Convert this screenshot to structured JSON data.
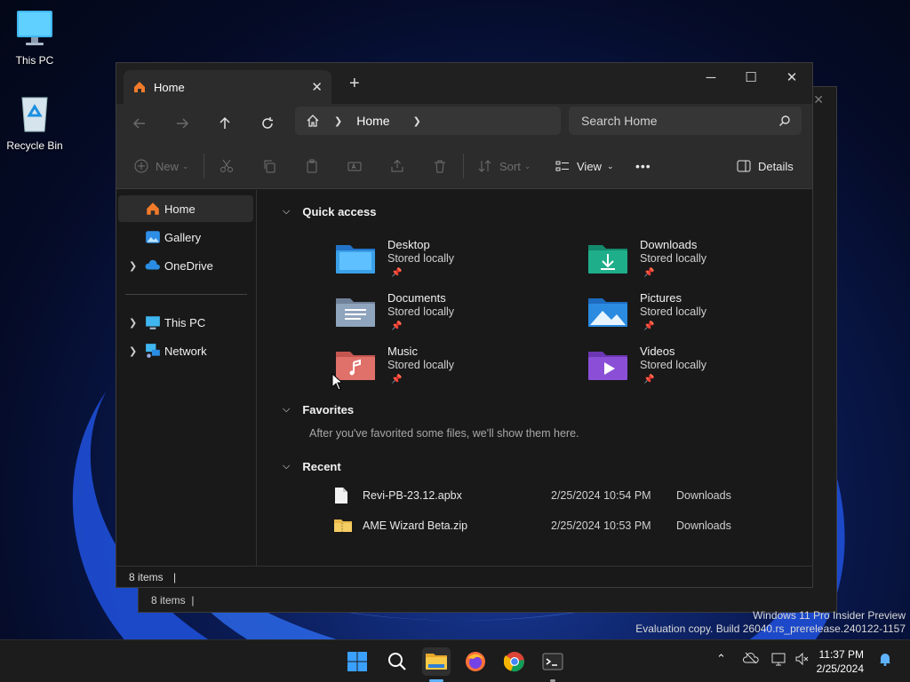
{
  "desktop": {
    "icons": [
      {
        "label": "This PC"
      },
      {
        "label": "Recycle Bin"
      }
    ],
    "watermark": {
      "line1": "Windows 11 Pro Insider Preview",
      "line2": "Evaluation copy. Build 26040.rs_prerelease.240122-1157"
    }
  },
  "background_window": {
    "status": "8 items"
  },
  "window": {
    "tab_title": "Home",
    "controls": {
      "minimize": "─",
      "maximize": "☐",
      "close": "✕"
    },
    "address": {
      "crumb": "Home"
    },
    "search": {
      "placeholder": "Search Home"
    },
    "toolbar": {
      "new": "New",
      "sort": "Sort",
      "view": "View",
      "more": "•••",
      "details": "Details"
    },
    "sidebar": {
      "items": [
        {
          "label": "Home"
        },
        {
          "label": "Gallery"
        },
        {
          "label": "OneDrive"
        },
        {
          "label": "This PC"
        },
        {
          "label": "Network"
        }
      ]
    },
    "sections": {
      "quick_access": "Quick access",
      "favorites": "Favorites",
      "favorites_empty": "After you've favorited some files, we'll show them here.",
      "recent": "Recent"
    },
    "quick_access": [
      {
        "name": "Desktop",
        "status": "Stored locally",
        "color": "#3aa0e8"
      },
      {
        "name": "Downloads",
        "status": "Stored locally",
        "color": "#1fae8a"
      },
      {
        "name": "Documents",
        "status": "Stored locally",
        "color": "#8fa4bd"
      },
      {
        "name": "Pictures",
        "status": "Stored locally",
        "color": "#2b8be0"
      },
      {
        "name": "Music",
        "status": "Stored locally",
        "color": "#e0706a"
      },
      {
        "name": "Videos",
        "status": "Stored locally",
        "color": "#8a4fd6"
      }
    ],
    "recent": [
      {
        "name": "Revi-PB-23.12.apbx",
        "date": "2/25/2024 10:54 PM",
        "location": "Downloads"
      },
      {
        "name": "AME Wizard Beta.zip",
        "date": "2/25/2024 10:53 PM",
        "location": "Downloads"
      }
    ],
    "status": "8 items"
  },
  "taskbar": {
    "clock_time": "11:37 PM",
    "clock_date": "2/25/2024"
  }
}
